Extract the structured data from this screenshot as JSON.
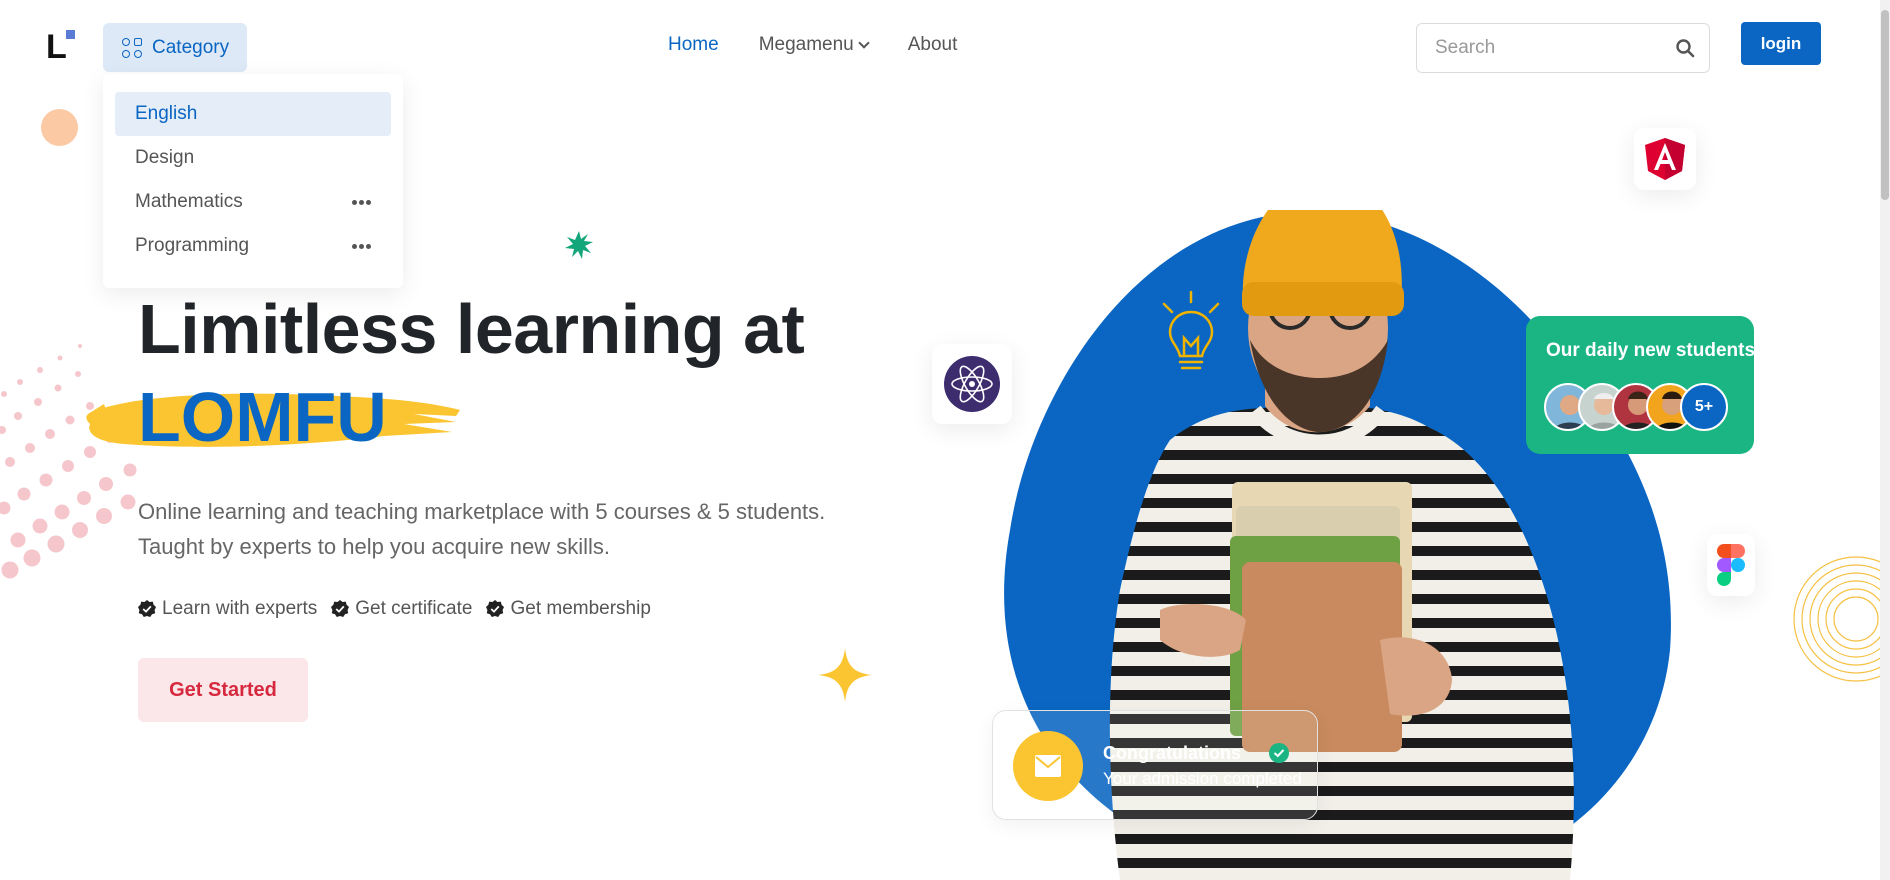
{
  "header": {
    "logo_letter": "L",
    "category_label": "Category",
    "nav": [
      {
        "label": "Home",
        "active": true
      },
      {
        "label": "Megamenu",
        "active": false,
        "has_dropdown": true
      },
      {
        "label": "About",
        "active": false
      }
    ],
    "search_placeholder": "Search",
    "login_label": "login"
  },
  "category_menu": {
    "items": [
      {
        "label": "English",
        "active": true,
        "has_more": false
      },
      {
        "label": "Design",
        "active": false,
        "has_more": false
      },
      {
        "label": "Mathematics",
        "active": false,
        "has_more": true
      },
      {
        "label": "Programming",
        "active": false,
        "has_more": true
      }
    ]
  },
  "hero": {
    "title_line1": "Limitless learning at",
    "title_brand": "LOMFU",
    "description_line1": "Online learning and teaching marketplace with 5 courses & 5 students.",
    "description_line2": "Taught by experts to help you acquire new skills.",
    "features": [
      "Learn with experts",
      "Get certificate",
      "Get membership"
    ],
    "cta_label": "Get Started"
  },
  "students_card": {
    "title": "Our daily new students",
    "more_label": "5+"
  },
  "congrats_card": {
    "title": "Congratulations",
    "subtitle": "Your admission completed"
  },
  "colors": {
    "primary": "#0a66c2",
    "accent_yellow": "#fbc531",
    "green": "#1bb583",
    "cta_text": "#d6293e",
    "cta_bg": "#fbe7ea"
  },
  "icons": [
    "category-icon",
    "search-icon",
    "chevron-down-icon",
    "check-badge-icon",
    "angular-icon",
    "atom-icon",
    "figma-icon",
    "mail-icon",
    "lightbulb-icon",
    "star-icon"
  ]
}
